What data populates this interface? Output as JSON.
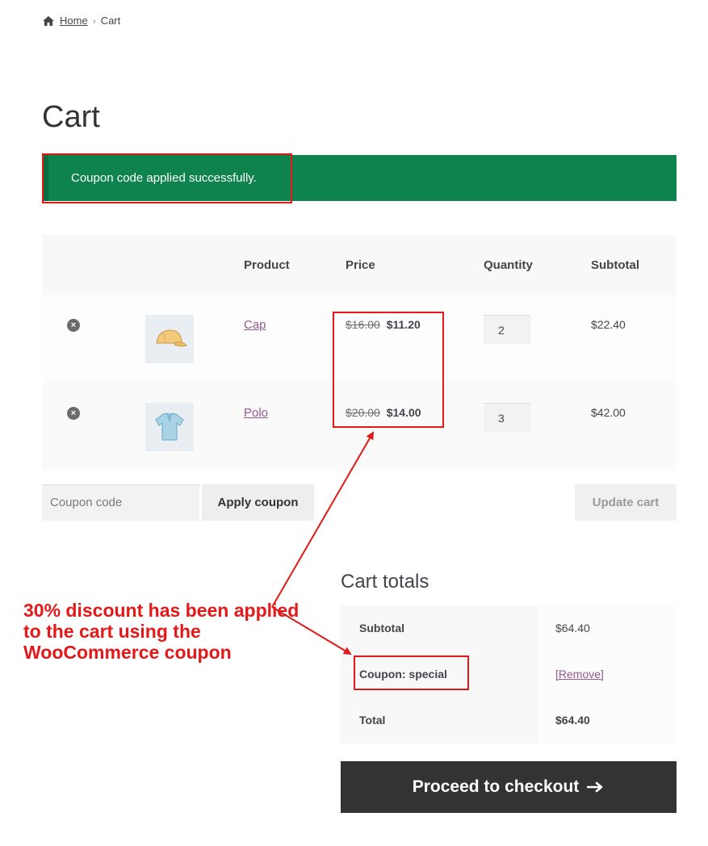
{
  "breadcrumb": {
    "home": "Home",
    "separator": "›",
    "current": "Cart"
  },
  "page_title": "Cart",
  "notice": "Coupon code applied successfully.",
  "table": {
    "headers": {
      "product": "Product",
      "price": "Price",
      "quantity": "Quantity",
      "subtotal": "Subtotal"
    },
    "rows": [
      {
        "name": "Cap",
        "old_price": "$16.00",
        "new_price": "$11.20",
        "quantity": "2",
        "subtotal": "$22.40",
        "thumb_icon": "cap-icon"
      },
      {
        "name": "Polo",
        "old_price": "$20.00",
        "new_price": "$14.00",
        "quantity": "3",
        "subtotal": "$42.00",
        "thumb_icon": "polo-shirt-icon"
      }
    ]
  },
  "coupon": {
    "placeholder": "Coupon code",
    "apply_label": "Apply coupon",
    "update_label": "Update cart"
  },
  "totals": {
    "title": "Cart totals",
    "subtotal_label": "Subtotal",
    "subtotal_value": "$64.40",
    "coupon_label": "Coupon: special",
    "coupon_remove": "[Remove]",
    "total_label": "Total",
    "total_value": "$64.40"
  },
  "checkout_label": "Proceed to checkout",
  "annotation": "30% discount has been applied to the cart using the WooCommerce coupon",
  "colors": {
    "notice_bg": "#0f834d",
    "link": "#96588a",
    "checkout_bg": "#333333",
    "annotation": "#e31818"
  }
}
